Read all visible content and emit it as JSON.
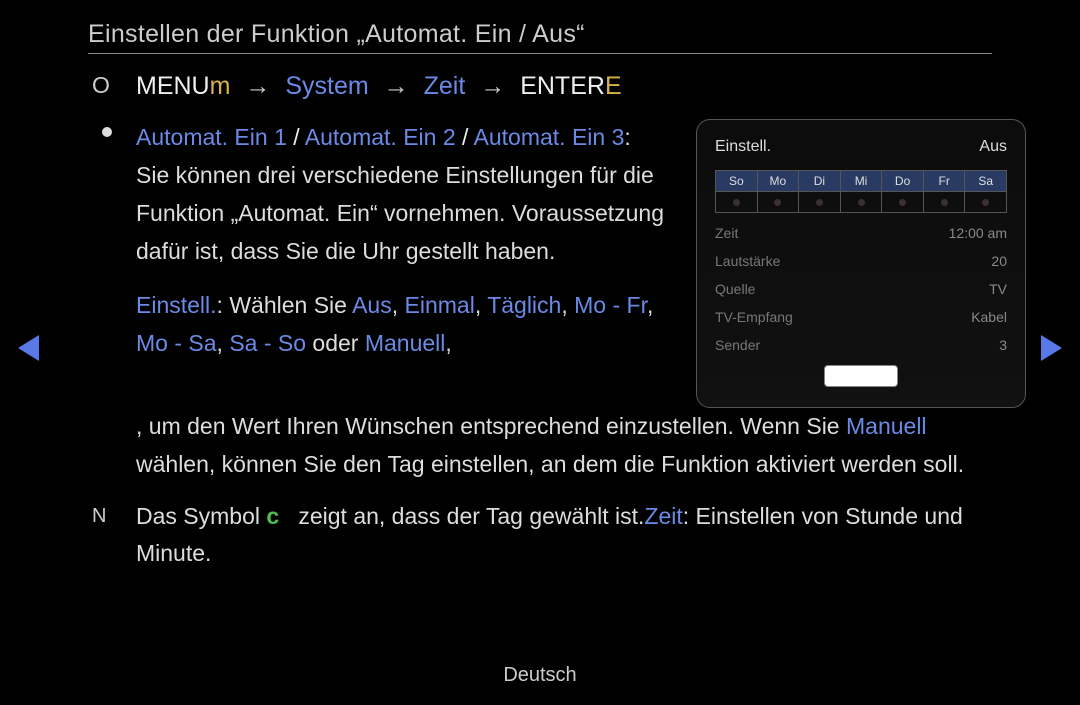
{
  "title": "Einstellen der Funktion „Automat. Ein / Aus“",
  "breadcrumb": {
    "o_marker": "O",
    "menu": "MENU",
    "m_lower": "m",
    "arrow": "→",
    "system": "System",
    "zeit": "Zeit",
    "enter": "ENTER",
    "e_trail": "E"
  },
  "body": {
    "auto1": "Automat. Ein 1",
    "slash": " / ",
    "auto2": "Automat. Ein 2",
    "auto3": "Automat. Ein 3",
    "after_auto": ": Sie können drei verschiedene Einstellungen für die Funktion „Automat. Ein“ vornehmen. Voraussetzung dafür ist, dass Sie die Uhr gestellt haben.",
    "einstell_label": "Einstell.",
    "einstell_after": ": Wählen Sie ",
    "aus": "Aus",
    "comma": ", ",
    "einmal": "Einmal",
    "taeglich": "Täglich",
    "mofr": "Mo - Fr",
    "mosa": "Mo - Sa",
    "saso": "Sa - So",
    "oder": " oder ",
    "manuell": "Manuell",
    "einstell_tail1": ", um den Wert Ihren Wünschen entsprechend einzustellen. Wenn Sie ",
    "manuell2": "Manuell",
    "einstell_tail2": " wählen, können Sie den Tag einstellen, an dem die Funktion aktiviert werden soll."
  },
  "note": {
    "n_marker": "N",
    "pre": "Das Symbol ",
    "c": "c",
    "mid": " zeigt an, dass der Tag gewählt ist.",
    "zeit": "Zeit",
    "tail": ": Einstellen von Stunde und Minute."
  },
  "panel": {
    "header_left": "Einstell.",
    "header_right": "Aus",
    "days": [
      "So",
      "Mo",
      "Di",
      "Mi",
      "Do",
      "Fr",
      "Sa"
    ],
    "rows": [
      {
        "k": "Zeit",
        "v": "12:00 am"
      },
      {
        "k": "Lautstärke",
        "v": "20"
      },
      {
        "k": "Quelle",
        "v": "TV"
      },
      {
        "k": "TV-Empfang",
        "v": "Kabel"
      },
      {
        "k": "Sender",
        "v": "3"
      }
    ]
  },
  "footer_lang": "Deutsch"
}
